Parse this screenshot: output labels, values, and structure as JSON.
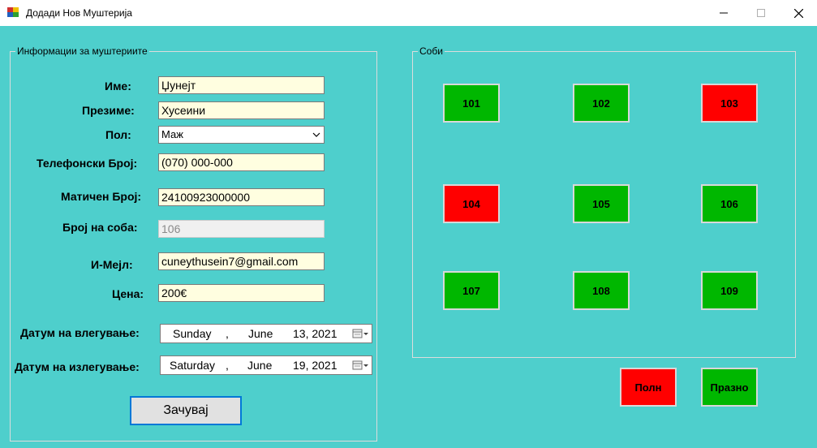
{
  "window": {
    "title": "Додади Нов Муштерија",
    "minimize_glyph": "—",
    "close_glyph": "✕"
  },
  "customer_group": {
    "legend": "Информации за муштериите",
    "name": {
      "label": "Име:",
      "value": "Џунејт"
    },
    "surname": {
      "label": "Презиме:",
      "value": "Хусеини"
    },
    "gender": {
      "label": "Пол:",
      "value": "Маж"
    },
    "phone": {
      "label": "Телефонски Број:",
      "value": "(070) 000-000"
    },
    "embg": {
      "label": "Матичен Број:",
      "value": "24100923000000"
    },
    "room_number": {
      "label": "Број на соба:",
      "value": "106"
    },
    "email": {
      "label": "И-Мејл:",
      "value": "cuneythusein7@gmail.com"
    },
    "price": {
      "label": "Цена:",
      "value": "200€"
    },
    "checkin": {
      "label": "Датум на влегување:",
      "weekday": "Sunday",
      "sep": ",",
      "month": "June",
      "day_year": "13, 2021"
    },
    "checkout": {
      "label": "Датум на излегување:",
      "weekday": "Saturday",
      "sep": ",",
      "month": "June",
      "day_year": "19, 2021"
    },
    "save_label": "Зачувај"
  },
  "rooms_group": {
    "legend": "Соби",
    "rooms": [
      {
        "number": "101",
        "status": "free",
        "color": "#00b700"
      },
      {
        "number": "102",
        "status": "free",
        "color": "#00b700"
      },
      {
        "number": "103",
        "status": "full",
        "color": "#ff0000"
      },
      {
        "number": "104",
        "status": "full",
        "color": "#ff0000"
      },
      {
        "number": "105",
        "status": "free",
        "color": "#00b700"
      },
      {
        "number": "106",
        "status": "free",
        "color": "#00b700"
      },
      {
        "number": "107",
        "status": "free",
        "color": "#00b700"
      },
      {
        "number": "108",
        "status": "free",
        "color": "#00b700"
      },
      {
        "number": "109",
        "status": "free",
        "color": "#00b700"
      }
    ]
  },
  "legend_items": {
    "full_label": "Полн",
    "empty_label": "Празно"
  },
  "colors": {
    "background": "#4ecfcc",
    "free": "#00b700",
    "full": "#ff0000",
    "input_bg": "#fffee0"
  }
}
